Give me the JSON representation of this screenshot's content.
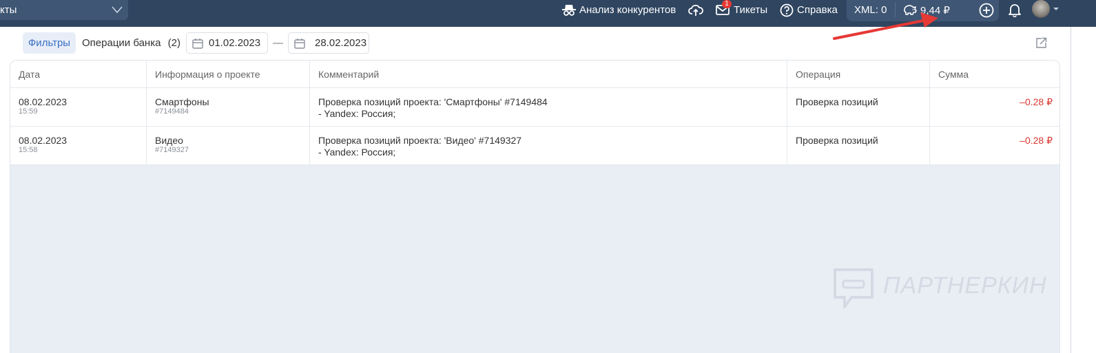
{
  "topbar": {
    "project_selector": "кты",
    "competitors_label": "Анализ конкурентов",
    "tickets_label": "Тикеты",
    "tickets_badge": "1",
    "help_label": "Справка",
    "xml_label": "XML: 0",
    "balance_label": "9,44 ₽"
  },
  "filters": {
    "filters_button": "Фильтры",
    "bank_ops_label": "Операции банка",
    "bank_ops_count": "(2)",
    "date_from": "01.02.2023",
    "date_separator": "—",
    "date_to": "28.02.2023"
  },
  "table": {
    "headers": [
      "Дата",
      "Информация о проекте",
      "Комментарий",
      "Операция",
      "Сумма"
    ],
    "rows": [
      {
        "date": "08.02.2023",
        "time": "15:59",
        "project": "Смартфоны",
        "project_id": "#7149484",
        "comment_line1": "Проверка позиций проекта: 'Смартфоны' #7149484",
        "comment_line2": "- Yandex: Россия;",
        "operation": "Проверка позиций",
        "amount": "–0.28 ₽"
      },
      {
        "date": "08.02.2023",
        "time": "15:58",
        "project": "Видео",
        "project_id": "#7149327",
        "comment_line1": "Проверка позиций проекта: 'Видео' #7149327",
        "comment_line2": "- Yandex: Россия;",
        "operation": "Проверка позиций",
        "amount": "–0.28 ₽"
      }
    ]
  },
  "watermark": "ПАРТНЕРКИН",
  "colors": {
    "topbar": "#2f4560",
    "accent": "#3a6fc4",
    "negative_amount": "#d9352f",
    "annotation_arrow": "#e53935",
    "empty_area": "#e9eef5"
  }
}
